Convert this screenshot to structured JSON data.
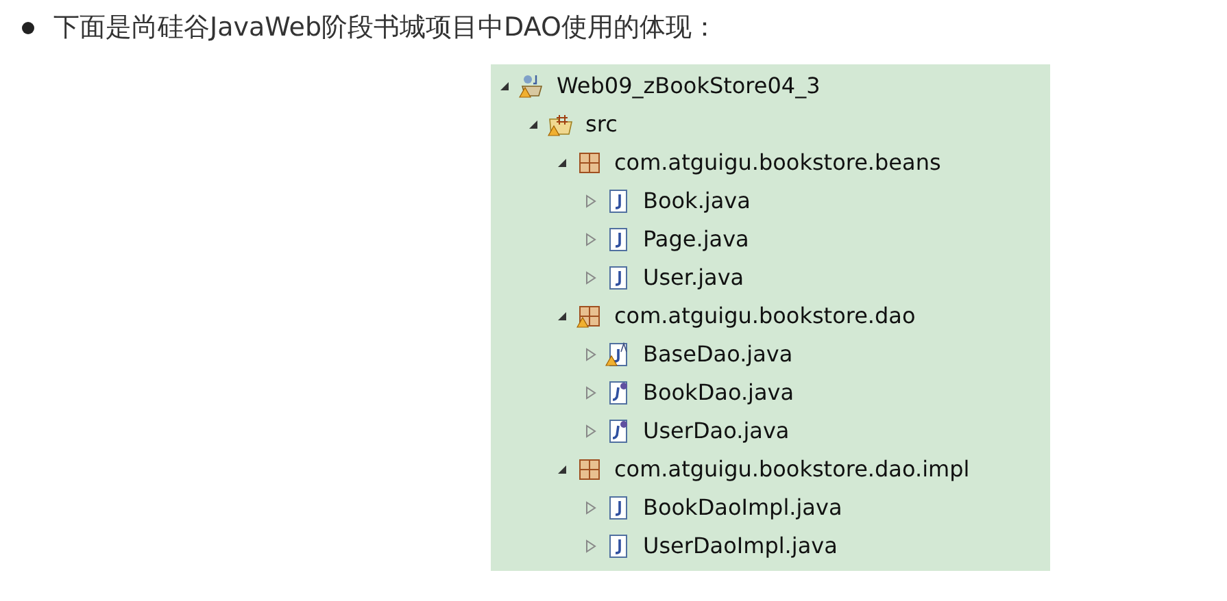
{
  "intro": {
    "text": "下面是尚硅谷JavaWeb阶段书城项目中DAO使用的体现："
  },
  "tree": [
    {
      "label": "Web09_zBookStore04_3",
      "kind": "project",
      "warning": true,
      "expanded": true,
      "children": [
        {
          "label": "src",
          "kind": "source-folder",
          "warning": true,
          "expanded": true,
          "children": [
            {
              "label": "com.atguigu.bookstore.beans",
              "kind": "package",
              "warning": false,
              "expanded": true,
              "children": [
                {
                  "label": "Book.java",
                  "kind": "class",
                  "warning": false,
                  "expanded": false
                },
                {
                  "label": "Page.java",
                  "kind": "class",
                  "warning": false,
                  "expanded": false
                },
                {
                  "label": "User.java",
                  "kind": "class",
                  "warning": false,
                  "expanded": false
                }
              ]
            },
            {
              "label": "com.atguigu.bookstore.dao",
              "kind": "package",
              "warning": true,
              "expanded": true,
              "children": [
                {
                  "label": "BaseDao.java",
                  "kind": "abstract-class",
                  "warning": true,
                  "expanded": false
                },
                {
                  "label": "BookDao.java",
                  "kind": "interface",
                  "warning": false,
                  "expanded": false
                },
                {
                  "label": "UserDao.java",
                  "kind": "interface",
                  "warning": false,
                  "expanded": false
                }
              ]
            },
            {
              "label": "com.atguigu.bookstore.dao.impl",
              "kind": "package",
              "warning": false,
              "expanded": true,
              "children": [
                {
                  "label": "BookDaoImpl.java",
                  "kind": "class",
                  "warning": false,
                  "expanded": false
                },
                {
                  "label": "UserDaoImpl.java",
                  "kind": "class",
                  "warning": false,
                  "expanded": false
                }
              ]
            }
          ]
        }
      ]
    }
  ]
}
